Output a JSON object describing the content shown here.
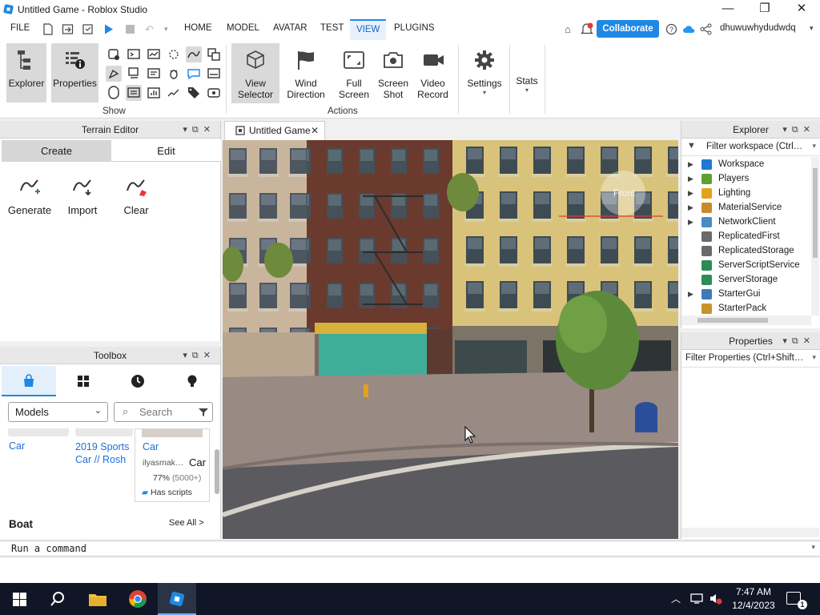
{
  "window": {
    "title": "Untitled Game - Roblox Studio",
    "minimize": "—",
    "maximize": "❐",
    "close": "✕"
  },
  "menu": {
    "file": "FILE",
    "tabs": [
      "HOME",
      "MODEL",
      "AVATAR",
      "TEST",
      "VIEW",
      "PLUGINS"
    ],
    "active_tab": "VIEW",
    "collaborate": "Collaborate",
    "username": "dhuwuwhydudwdq"
  },
  "ribbon": {
    "show_group_label": "Show",
    "actions_group_label": "Actions",
    "explorer": "Explorer",
    "properties": "Properties",
    "view_selector": [
      "View",
      "Selector"
    ],
    "wind_direction": [
      "Wind",
      "Direction"
    ],
    "full_screen": [
      "Full",
      "Screen"
    ],
    "screen_shot": [
      "Screen",
      "Shot"
    ],
    "video_record": [
      "Video",
      "Record"
    ],
    "settings": "Settings",
    "stats": "Stats"
  },
  "terrain_editor": {
    "title": "Terrain Editor",
    "tabs": {
      "create": "Create",
      "edit": "Edit"
    },
    "tools": [
      "Generate",
      "Import",
      "Clear"
    ]
  },
  "toolbox": {
    "title": "Toolbox",
    "category": "Models",
    "search_placeholder": "Search",
    "items": [
      {
        "title": "Car"
      },
      {
        "title": "2019 Sports Car // Rosh"
      },
      {
        "title": "Car",
        "creator": "ilyasmak…",
        "rating": "77%",
        "votes": "(5000+)",
        "badge": "Has scripts"
      }
    ],
    "tooltip": "Car",
    "section": "Boat",
    "see_all": "See All >"
  },
  "viewport": {
    "tab": "Untitled Game",
    "view_cube_label": "Front"
  },
  "explorer": {
    "title": "Explorer",
    "filter_placeholder": "Filter workspace (Ctrl…",
    "items": [
      {
        "label": "Workspace",
        "expandable": true,
        "icon_color": "#1f7ad1"
      },
      {
        "label": "Players",
        "expandable": true,
        "icon_color": "#5da130"
      },
      {
        "label": "Lighting",
        "expandable": true,
        "icon_color": "#e3a21a"
      },
      {
        "label": "MaterialService",
        "expandable": true,
        "icon_color": "#c88a2d"
      },
      {
        "label": "NetworkClient",
        "expandable": true,
        "icon_color": "#4a8bc2"
      },
      {
        "label": "ReplicatedFirst",
        "expandable": false,
        "icon_color": "#6a6a6a"
      },
      {
        "label": "ReplicatedStorage",
        "expandable": false,
        "icon_color": "#6a6a6a"
      },
      {
        "label": "ServerScriptService",
        "expandable": false,
        "icon_color": "#2e8b57"
      },
      {
        "label": "ServerStorage",
        "expandable": false,
        "icon_color": "#2e8b57"
      },
      {
        "label": "StarterGui",
        "expandable": true,
        "icon_color": "#3d7ab8"
      },
      {
        "label": "StarterPack",
        "expandable": false,
        "icon_color": "#c8922d"
      }
    ]
  },
  "properties": {
    "title": "Properties",
    "filter_placeholder": "Filter Properties (Ctrl+Shift…"
  },
  "command_bar": {
    "placeholder": "Run a command"
  },
  "taskbar": {
    "time": "7:47 AM",
    "date": "12/4/2023",
    "notification_count": "1"
  },
  "colors": {
    "accent": "#1e88e5",
    "taskbar": "#101626"
  }
}
